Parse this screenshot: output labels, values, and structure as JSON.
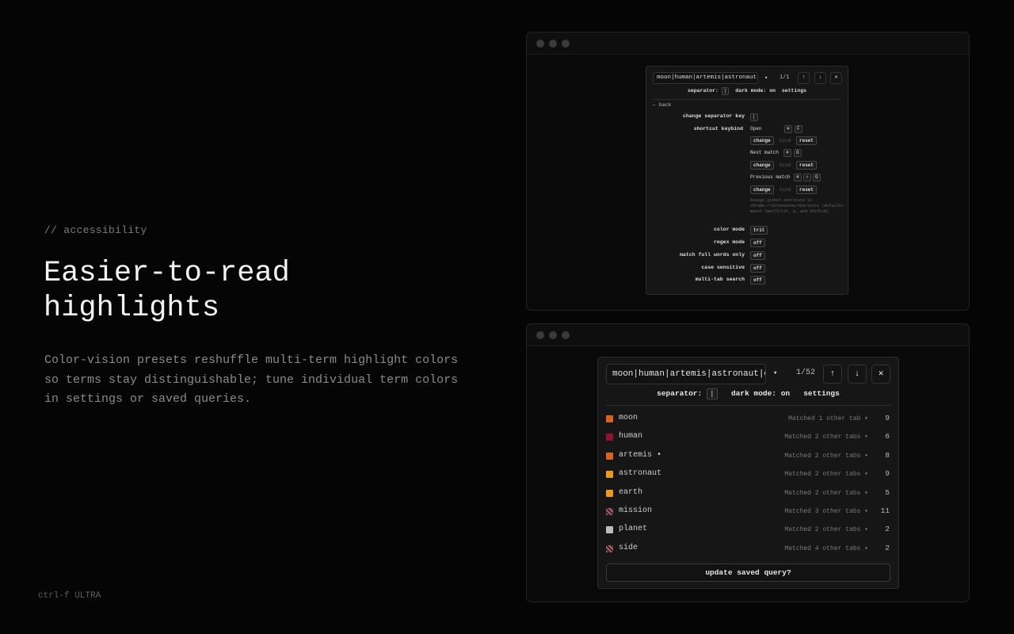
{
  "hero": {
    "eyebrow": "// accessibility",
    "headline": "Easier-to-read highlights",
    "description": "Color-vision presets reshuffle multi-term highlight colors so terms stay distinguishable; tune individual term colors in settings or saved queries.",
    "brand": "ctrl-f ULTRA"
  },
  "settings_panel": {
    "query": "moon|human|artemis|astronaut|earth|mission|planet|side",
    "caret": "▾",
    "count": "1/1",
    "prev_icon": "↑",
    "next_icon": "↓",
    "close_icon": "✕",
    "separator_label": "separator:",
    "separator_key": "|",
    "dark_mode": "dark mode: on",
    "settings_link": "settings",
    "back": "← back",
    "change_separator_label": "change separator key",
    "change_separator_value": "|",
    "shortcut_label": "shortcut keybind",
    "open_label": "Open",
    "open_keys": [
      "⌘",
      "F"
    ],
    "next_match_label": "Next match",
    "next_match_keys": [
      "⌘",
      "G"
    ],
    "prev_match_label": "Previous match",
    "prev_match_keys": [
      "⌘",
      "⇧",
      "G"
    ],
    "change_btn": "change",
    "bind_btn": "bind",
    "reset_btn": "reset",
    "note": "Assign global shortcuts in chrome://extensions/shortcuts (defaults match Cmd/Ctrl+F, G, and Shift+G)",
    "color_mode_label": "color mode",
    "color_mode_value": "trit",
    "regex_label": "regex mode",
    "regex_value": "off",
    "full_words_label": "match full words only",
    "full_words_value": "off",
    "case_label": "case sensitive",
    "case_value": "off",
    "multitab_label": "multi-tab search",
    "multitab_value": "off"
  },
  "search_panel": {
    "query": "moon|human|artemis|astronaut|earth|mission|planet|side",
    "caret": "▾",
    "count": "1/52",
    "prev_icon": "↑",
    "next_icon": "↓",
    "close_icon": "✕",
    "separator_label": "separator:",
    "separator_key": "|",
    "dark_mode": "dark mode: on",
    "settings_link": "settings",
    "terms": [
      {
        "name": "moon",
        "match": "Matched 1 other tab ▾",
        "count": "9",
        "color": "#d9631e",
        "pattern": false
      },
      {
        "name": "human",
        "match": "Matched 2 other tabs ▾",
        "count": "6",
        "color": "#8a1530",
        "pattern": false
      },
      {
        "name": "artemis •",
        "match": "Matched 2 other tabs ▾",
        "count": "8",
        "color": "#d9631e",
        "pattern": false
      },
      {
        "name": "astronaut",
        "match": "Matched 2 other tabs ▾",
        "count": "9",
        "color": "#e89a18",
        "pattern": false
      },
      {
        "name": "earth",
        "match": "Matched 2 other tabs ▾",
        "count": "5",
        "color": "#e89a18",
        "pattern": false
      },
      {
        "name": "mission",
        "match": "Matched 3 other tabs ▾",
        "count": "11",
        "color": "#c45a6a",
        "pattern": true
      },
      {
        "name": "planet",
        "match": "Matched 2 other tabs ▾",
        "count": "2",
        "color": "#bdbdbd",
        "pattern": false
      },
      {
        "name": "side",
        "match": "Matched 4 other tabs ▾",
        "count": "2",
        "color": "#c45a6a",
        "pattern": true
      }
    ],
    "update_button": "update saved query?"
  }
}
